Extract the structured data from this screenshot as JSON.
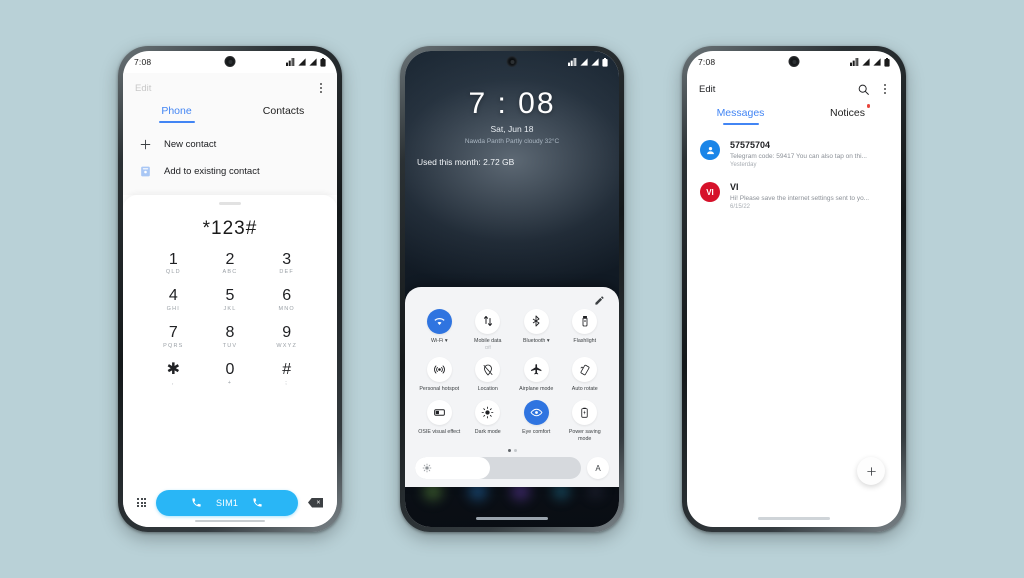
{
  "background_color": "#b9d1d7",
  "accent_blue": "#4285f4",
  "call_button_color": "#29b6f6",
  "qs_active_color": "#2f74e0",
  "phone_left": {
    "status_bar": {
      "time": "7:08",
      "icons": [
        "mobile-data-icon",
        "signal-icon",
        "signal-icon",
        "battery-icon"
      ]
    },
    "app_bar": {
      "edit_label": "Edit",
      "overflow_label": "more-options"
    },
    "tabs": [
      {
        "label": "Phone",
        "active": true
      },
      {
        "label": "Contacts",
        "active": false
      }
    ],
    "actions": [
      {
        "label": "New contact",
        "icon": "plus-icon"
      },
      {
        "label": "Add to existing contact",
        "icon": "contact-card-icon"
      }
    ],
    "dialer": {
      "entered_number": "*123#",
      "keys": [
        {
          "num": "1",
          "sub": "QLD"
        },
        {
          "num": "2",
          "sub": "ABC"
        },
        {
          "num": "3",
          "sub": "DEF"
        },
        {
          "num": "4",
          "sub": "GHI"
        },
        {
          "num": "5",
          "sub": "JKL"
        },
        {
          "num": "6",
          "sub": "MNO"
        },
        {
          "num": "7",
          "sub": "PQRS"
        },
        {
          "num": "8",
          "sub": "TUV"
        },
        {
          "num": "9",
          "sub": "WXYZ"
        },
        {
          "num": "✱",
          "sub": ","
        },
        {
          "num": "0",
          "sub": "+"
        },
        {
          "num": "#",
          "sub": ";"
        }
      ],
      "call_button_label": "SIM1",
      "keypad_toggle": "keypad-icon",
      "backspace": "backspace-icon"
    }
  },
  "phone_mid": {
    "status_bar": {
      "icons": [
        "mobile-data-icon",
        "signal-icon",
        "signal-icon",
        "battery-icon"
      ]
    },
    "lockscreen": {
      "clock": "7 : 08",
      "date": "Sat, Jun 18",
      "weather": "Nawda Panth Partly cloudy 32°C",
      "data_usage": "Used this month: 2.72 GB"
    },
    "quick_settings": {
      "edit_icon": "pencil-icon",
      "page_dots": [
        true,
        false
      ],
      "tiles": [
        {
          "label": "Wi-Fi ▾",
          "icon": "wifi-icon",
          "active": true,
          "sub": ""
        },
        {
          "label": "Mobile data",
          "icon": "mobile-data-icon",
          "active": false,
          "sub": "Off"
        },
        {
          "label": "Bluetooth ▾",
          "icon": "bluetooth-icon",
          "active": false,
          "sub": ""
        },
        {
          "label": "Flashlight",
          "icon": "flashlight-icon",
          "active": false,
          "sub": ""
        },
        {
          "label": "Personal hotspot",
          "icon": "hotspot-icon",
          "active": false,
          "sub": ""
        },
        {
          "label": "Location",
          "icon": "location-off-icon",
          "active": false,
          "sub": ""
        },
        {
          "label": "Airplane mode",
          "icon": "airplane-icon",
          "active": false,
          "sub": ""
        },
        {
          "label": "Auto rotate",
          "icon": "auto-rotate-icon",
          "active": false,
          "sub": ""
        },
        {
          "label": "OSIE visual effect",
          "icon": "contrast-icon",
          "active": false,
          "sub": ""
        },
        {
          "label": "Dark mode",
          "icon": "brightness-icon",
          "active": false,
          "sub": ""
        },
        {
          "label": "Eye comfort",
          "icon": "eye-comfort-icon",
          "active": true,
          "sub": ""
        },
        {
          "label": "Power saving mode",
          "icon": "battery-saver-icon",
          "active": false,
          "sub": ""
        }
      ],
      "brightness": {
        "value_percent": 45,
        "auto_label": "A",
        "icon": "brightness-sun-icon"
      }
    }
  },
  "phone_right": {
    "status_bar": {
      "time": "7:08",
      "icons": [
        "mobile-data-icon",
        "signal-icon",
        "signal-icon",
        "battery-icon"
      ]
    },
    "app_bar": {
      "edit_label": "Edit",
      "search_icon": "search-icon",
      "overflow_icon": "more-options-icon"
    },
    "tabs": [
      {
        "label": "Messages",
        "active": true,
        "badge": false
      },
      {
        "label": "Notices",
        "active": false,
        "badge": true
      }
    ],
    "messages": [
      {
        "sender": "57575704",
        "snippet": "Telegram code: 59417  You can also tap on thi...",
        "date": "Yesterday",
        "avatar_text": "",
        "avatar_color": "#1a85e8",
        "avatar_icon": "person-icon"
      },
      {
        "sender": "VI",
        "snippet": "Hi! Please save the internet settings sent to yo...",
        "date": "6/15/22",
        "avatar_text": "VI",
        "avatar_color": "#d6112a",
        "avatar_icon": ""
      }
    ],
    "fab": {
      "icon": "plus-icon",
      "label": "new-conversation"
    }
  }
}
